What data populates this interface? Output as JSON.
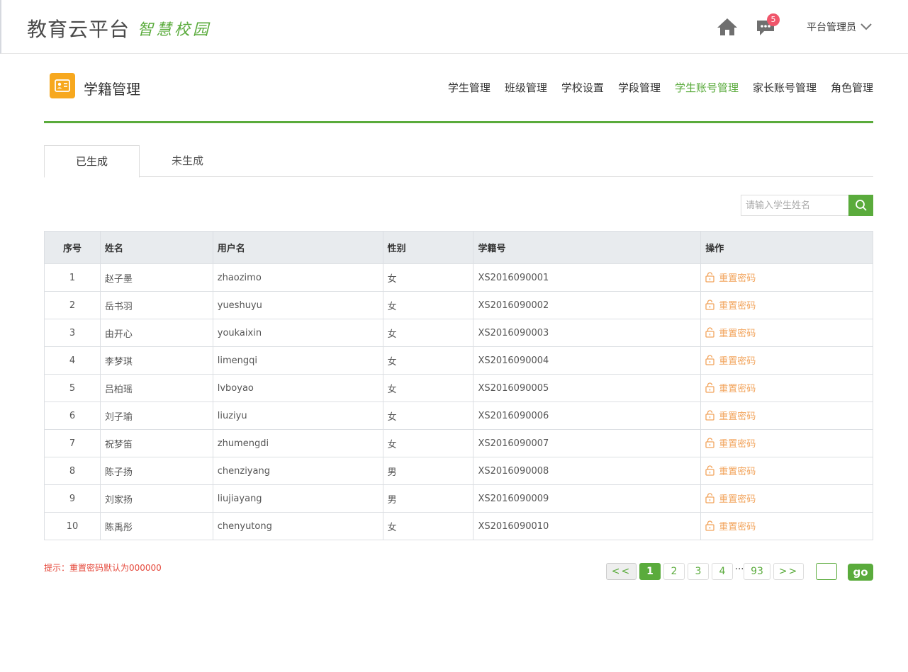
{
  "header": {
    "logo_main": "教育云平台",
    "logo_sub": "智慧校园",
    "message_count": "5",
    "user_name": "平台管理员"
  },
  "module": {
    "title": "学籍管理",
    "nav": [
      "学生管理",
      "班级管理",
      "学校设置",
      "学段管理",
      "学生账号管理",
      "家长账号管理",
      "角色管理"
    ],
    "active_nav": "学生账号管理"
  },
  "tabs": {
    "generated": "已生成",
    "not_generated": "未生成"
  },
  "search": {
    "placeholder": "请输入学生姓名"
  },
  "table": {
    "headers": {
      "idx": "序号",
      "name": "姓名",
      "username": "用户名",
      "gender": "性别",
      "student_no": "学籍号",
      "action": "操作"
    },
    "action_label": "重置密码",
    "rows": [
      {
        "idx": "1",
        "name": "赵子墨",
        "username": "zhaozimo",
        "gender": "女",
        "student_no": "XS2016090001"
      },
      {
        "idx": "2",
        "name": "岳书羽",
        "username": "yueshuyu",
        "gender": "女",
        "student_no": "XS2016090002"
      },
      {
        "idx": "3",
        "name": "由开心",
        "username": "youkaixin",
        "gender": "女",
        "student_no": "XS2016090003"
      },
      {
        "idx": "4",
        "name": "李梦琪",
        "username": "limengqi",
        "gender": "女",
        "student_no": "XS2016090004"
      },
      {
        "idx": "5",
        "name": "吕柏瑶",
        "username": "lvboyao",
        "gender": "女",
        "student_no": "XS2016090005"
      },
      {
        "idx": "6",
        "name": "刘子瑜",
        "username": "liuziyu",
        "gender": "女",
        "student_no": "XS2016090006"
      },
      {
        "idx": "7",
        "name": "祝梦笛",
        "username": "zhumengdi",
        "gender": "女",
        "student_no": "XS2016090007"
      },
      {
        "idx": "8",
        "name": "陈子扬",
        "username": "chenziyang",
        "gender": "男",
        "student_no": "XS2016090008"
      },
      {
        "idx": "9",
        "name": "刘家扬",
        "username": "liujiayang",
        "gender": "男",
        "student_no": "XS2016090009"
      },
      {
        "idx": "10",
        "name": "陈禹彤",
        "username": "chenyutong",
        "gender": "女",
        "student_no": "XS2016090010"
      }
    ]
  },
  "footer": {
    "hint": "提示：重置密码默认为000000",
    "prev": "<<",
    "pages": [
      "1",
      "2",
      "3",
      "4"
    ],
    "ellipsis": "···",
    "last_page": "93",
    "next": ">>",
    "go": "go",
    "current_page": "1"
  },
  "colors": {
    "brand_green": "#5aab3c",
    "module_orange": "#f7a81e",
    "badge_red": "#f0566b",
    "action_orange": "#f2a45c",
    "hint_red": "#e5483b"
  }
}
